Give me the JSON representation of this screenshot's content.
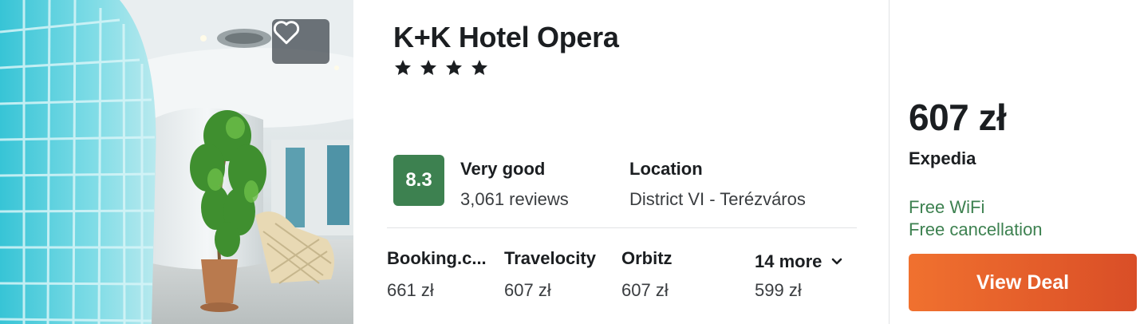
{
  "hotel": {
    "name": "K+K Hotel Opera",
    "star_count": 4,
    "rating": {
      "score": "8.3",
      "label": "Very good",
      "reviews": "3,061 reviews",
      "badge_color": "#3d8150"
    },
    "location": {
      "label": "Location",
      "value": "District VI - Terézváros"
    },
    "photo": {
      "icon": "favorite-heart-icon"
    }
  },
  "providers": [
    {
      "name": "Booking.c...",
      "price": "661 zł"
    },
    {
      "name": "Travelocity",
      "price": "607 zł"
    },
    {
      "name": "Orbitz",
      "price": "607 zł"
    }
  ],
  "more_providers": {
    "label": "14 more",
    "price": "599 zł",
    "icon": "chevron-down-icon"
  },
  "deal": {
    "price": "607 zł",
    "provider": "Expedia",
    "amenities": [
      "Free WiFi",
      "Free cancellation"
    ],
    "amenity_color": "#3d8150",
    "button_label": "View Deal",
    "button_color": "#e8622c"
  }
}
